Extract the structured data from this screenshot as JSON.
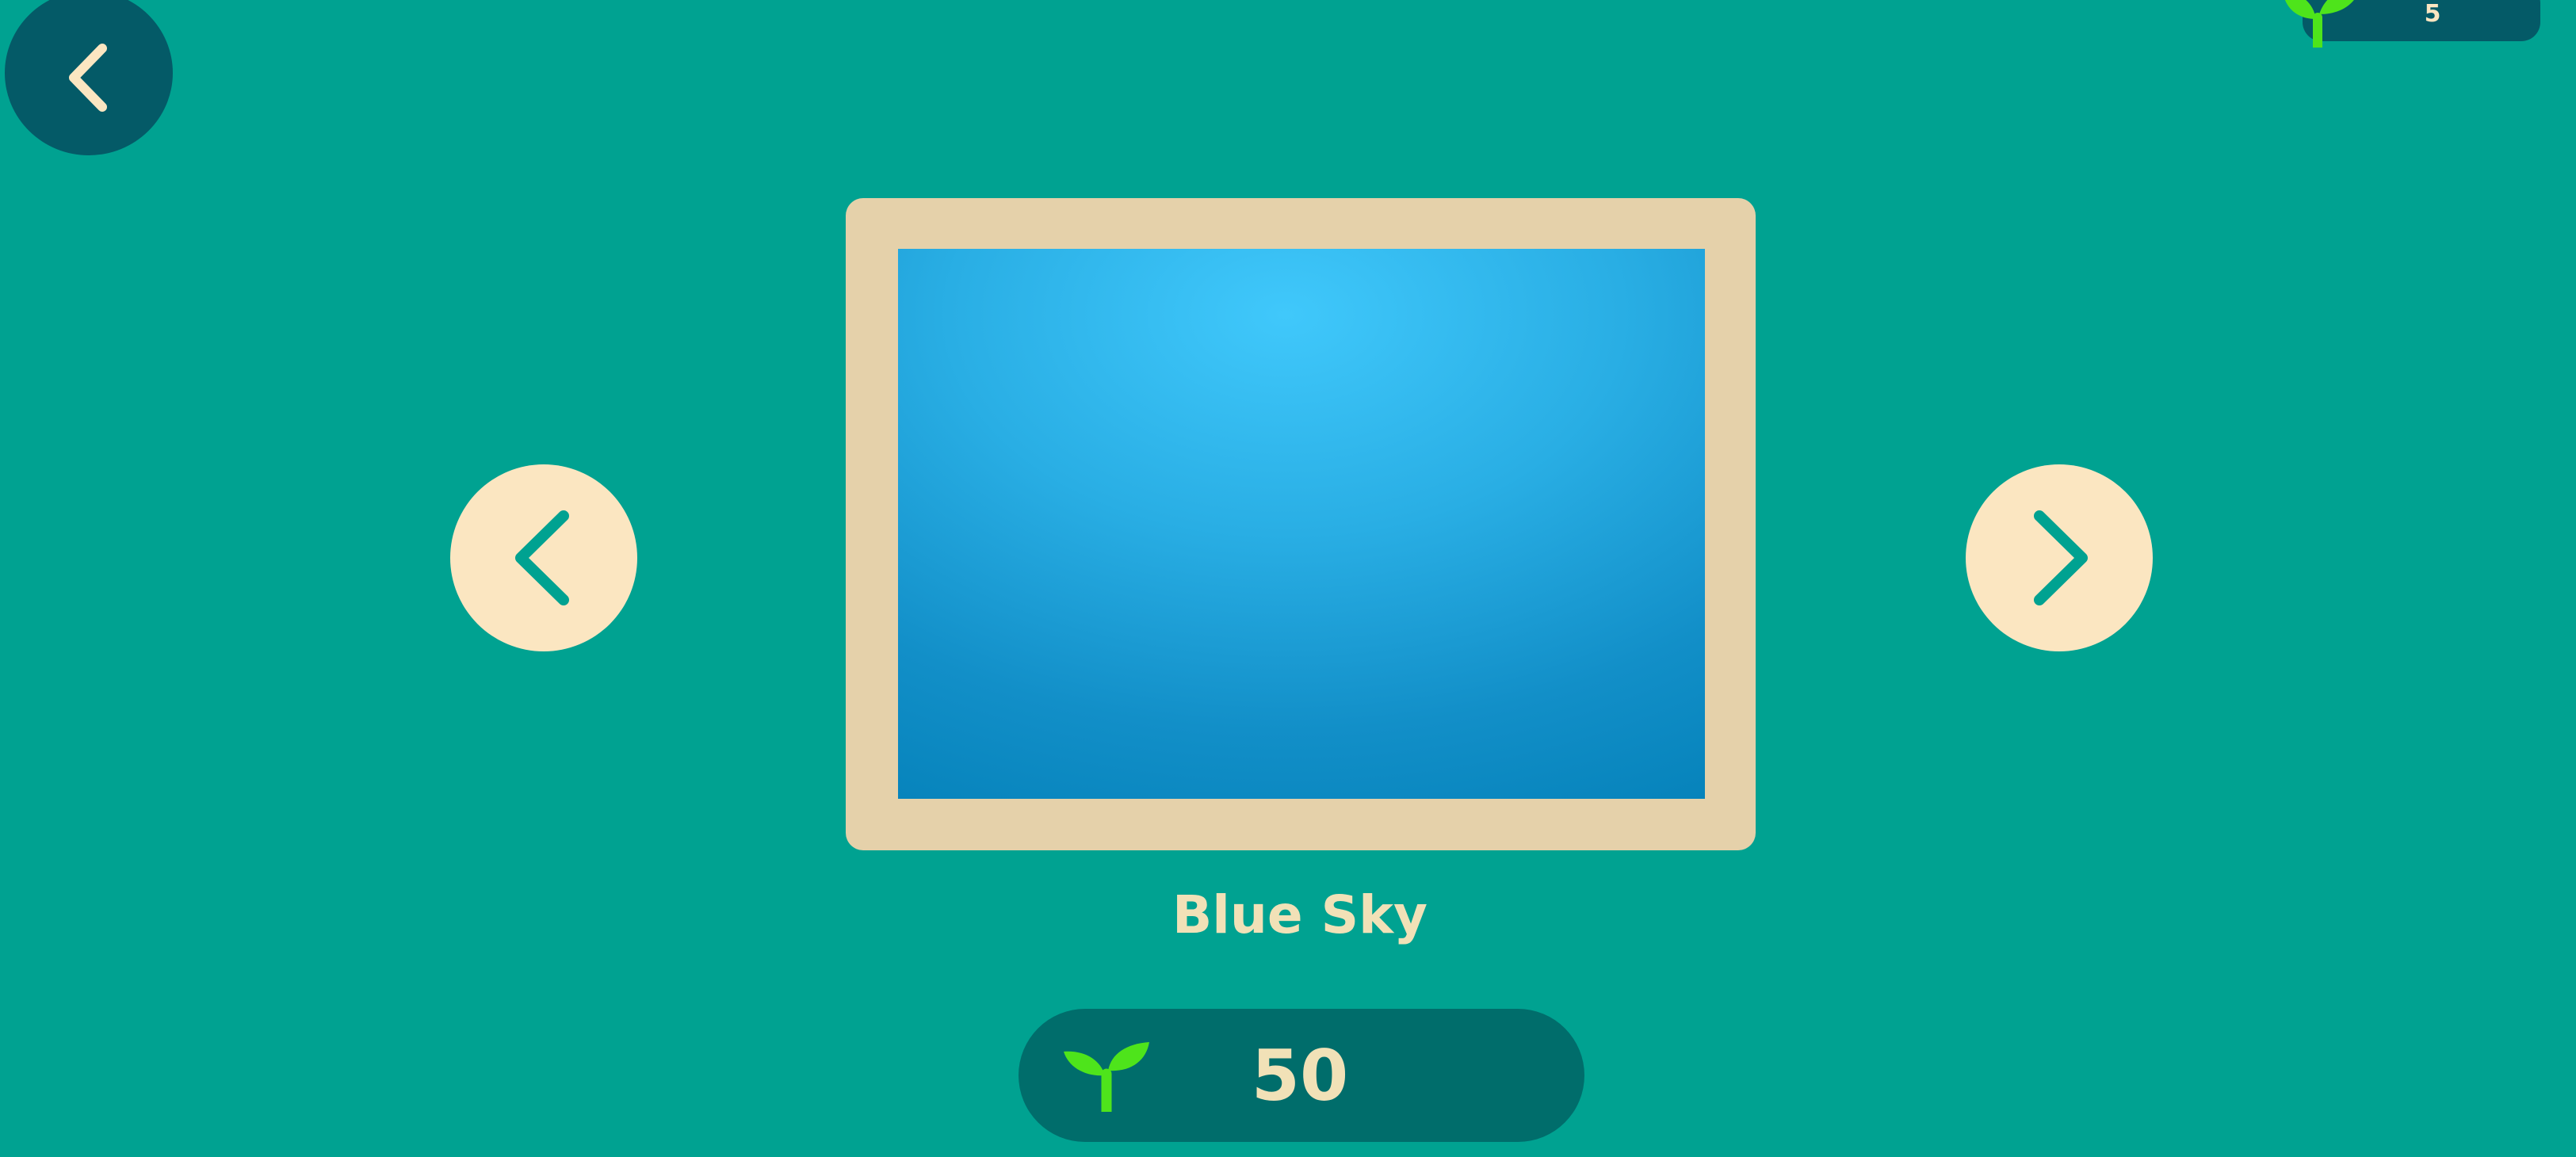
{
  "icons": {
    "back": "chevron-left-icon",
    "prev": "chevron-left-icon",
    "next": "chevron-right-icon",
    "currency": "sprout-icon"
  },
  "colors": {
    "background": "#00a291",
    "dark_teal": "#045a67",
    "price_pill": "#006d6b",
    "cream": "#fbe6c1",
    "frame": "#e5d1aa",
    "sprout_green": "#4ee41b",
    "sky_light": "#40c8fb",
    "sky_dark": "#0481b9"
  },
  "wallet": {
    "count": "5"
  },
  "item": {
    "name": "Blue Sky",
    "price": "50"
  }
}
